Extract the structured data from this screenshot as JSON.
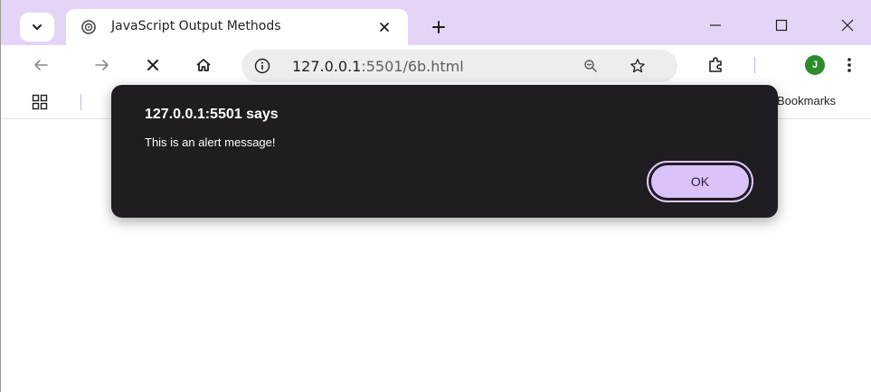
{
  "browser": {
    "tab": {
      "title": "JavaScript Output Methods"
    },
    "address": {
      "host": "127.0.0.1",
      "rest": ":5501/6b.html"
    },
    "profile_initial": "J",
    "bookmarks_label": "Bookmarks"
  },
  "dialog": {
    "title": "127.0.0.1:5501 says",
    "message": "This is an alert message!",
    "ok_label": "OK"
  },
  "colors": {
    "titlebar": "#e4d5f7",
    "dialog_bg": "#1f1c22",
    "ok_button": "#dcc2fb",
    "avatar": "#2e8b2e"
  },
  "icons": [
    "tab-search-icon",
    "favicon-icon",
    "close-icon",
    "plus-icon",
    "minimize-icon",
    "maximize-icon",
    "back-icon",
    "forward-icon",
    "stop-icon",
    "home-icon",
    "info-icon",
    "zoom-icon",
    "star-icon",
    "extensions-icon",
    "menu-icon",
    "apps-icon"
  ]
}
